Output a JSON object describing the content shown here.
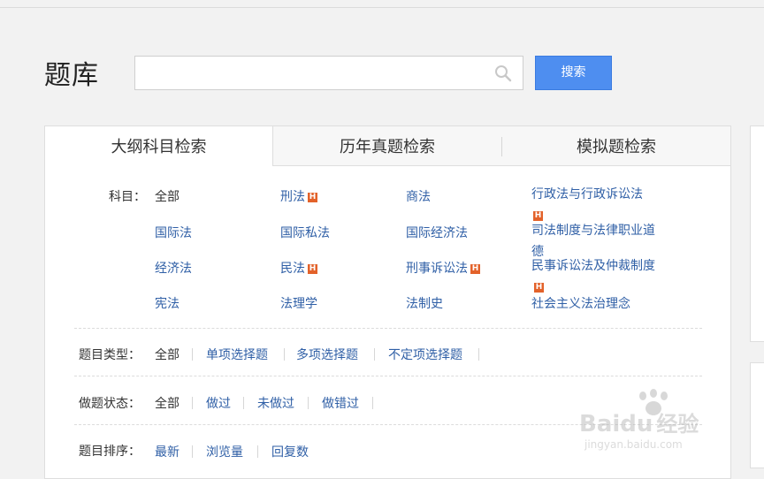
{
  "page": {
    "title": "题库"
  },
  "search": {
    "placeholder": "",
    "button_label": "搜索"
  },
  "tabs": [
    {
      "label": "大纲科目检索",
      "active": true
    },
    {
      "label": "历年真题检索",
      "active": false
    },
    {
      "label": "模拟题检索",
      "active": false
    }
  ],
  "subjects": {
    "label": "科目：",
    "all": "全部",
    "items": [
      {
        "label": "刑法",
        "hot": true
      },
      {
        "label": "商法",
        "hot": false
      },
      {
        "label": "行政法与行政诉讼法",
        "hot": true
      },
      {
        "label": "国际法",
        "hot": false
      },
      {
        "label": "国际私法",
        "hot": false
      },
      {
        "label": "国际经济法",
        "hot": false
      },
      {
        "label": "司法制度与法律职业道德",
        "hot": false
      },
      {
        "label": "经济法",
        "hot": false
      },
      {
        "label": "民法",
        "hot": true
      },
      {
        "label": "刑事诉讼法",
        "hot": true
      },
      {
        "label": "民事诉讼法及仲裁制度",
        "hot": true
      },
      {
        "label": "宪法",
        "hot": false
      },
      {
        "label": "法理学",
        "hot": false
      },
      {
        "label": "法制史",
        "hot": false
      },
      {
        "label": "社会主义法治理念",
        "hot": false
      }
    ],
    "hot_badge": "H"
  },
  "question_type": {
    "label": "题目类型：",
    "options": [
      "全部",
      "单项选择题",
      "多项选择题",
      "不定项选择题"
    ]
  },
  "status": {
    "label": "做题状态：",
    "options": [
      "全部",
      "做过",
      "未做过",
      "做错过"
    ]
  },
  "sort": {
    "label": "题目排序：",
    "options": [
      "最新",
      "浏览量",
      "回复数"
    ]
  },
  "watermark": {
    "brand": "Bai",
    "brand2": "du",
    "suffix": "经验",
    "url": "jingyan.baidu.com"
  },
  "colors": {
    "link": "#2f5fa6",
    "button": "#4e8ef0",
    "hot_badge": "#e3622a"
  }
}
